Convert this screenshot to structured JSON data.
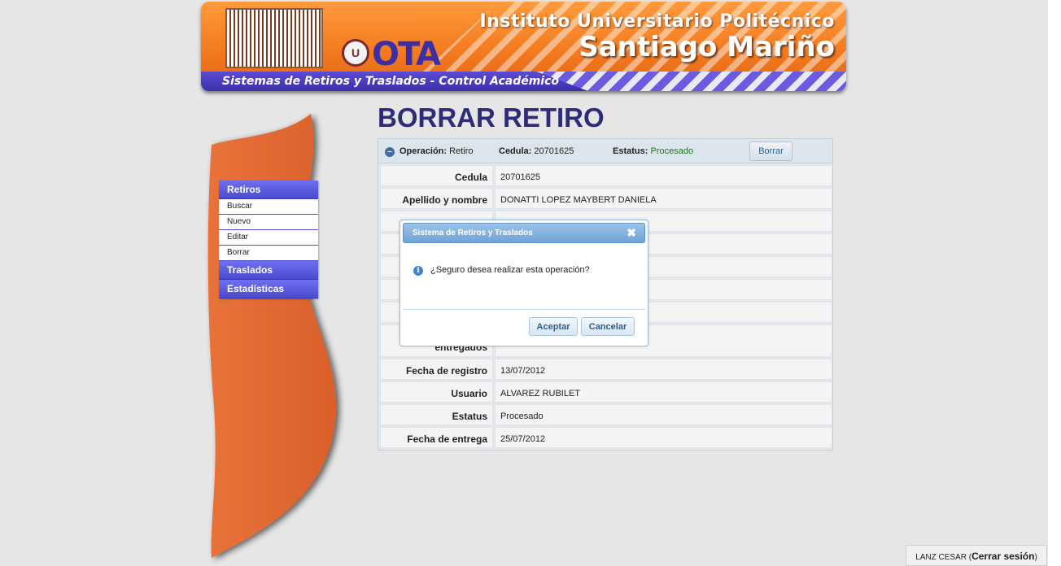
{
  "banner": {
    "institute": "Instituto Universitario Politécnico",
    "name": "Santiago Mariño",
    "subtitle": "Sistemas de Retiros y Traslados - Control Académico",
    "ota_text": "OTA",
    "logo_icon": "iuspsm-logo-icon"
  },
  "sidebar": {
    "sections": [
      {
        "label": "Retiros",
        "items": [
          "Buscar",
          "Nuevo",
          "Editar",
          "Borrar"
        ]
      },
      {
        "label": "Traslados"
      },
      {
        "label": "Estadísticas"
      }
    ]
  },
  "page": {
    "title": "BORRAR RETIRO"
  },
  "panel": {
    "op_label": "Operación:",
    "op_value": "Retiro",
    "ced_label": "Cedula:",
    "ced_value": "20701625",
    "est_label": "Estatus:",
    "est_value": "Procesado",
    "est_color": "#1a7a1a",
    "borrar_button": "Borrar",
    "rows": [
      {
        "label": "Cedula",
        "value": "20701625"
      },
      {
        "label": "Apellido y nombre",
        "value": "DONATTI LOPEZ MAYBERT DANIELA"
      },
      {
        "label": "",
        "value": ""
      },
      {
        "label": "",
        "value": ""
      },
      {
        "label": "",
        "value": ""
      },
      {
        "label": "",
        "value": ""
      },
      {
        "label": "",
        "value": ""
      },
      {
        "label": "entregados",
        "value": ""
      },
      {
        "label": "Fecha de registro",
        "value": "13/07/2012"
      },
      {
        "label": "Usuario",
        "value": "ALVAREZ RUBILET"
      },
      {
        "label": "Estatus",
        "value": "Procesado"
      },
      {
        "label": "Fecha de entrega",
        "value": "25/07/2012"
      }
    ]
  },
  "modal": {
    "title": "Sistema de Retiros y Traslados",
    "message": "¿Seguro desea realizar esta operación?",
    "ok_label": "Aceptar",
    "cancel_label": "Cancelar",
    "close_icon": "close-icon",
    "info_icon": "info-icon"
  },
  "session": {
    "user": "LANZ CESAR",
    "logout_label": "Cerrar sesión"
  }
}
